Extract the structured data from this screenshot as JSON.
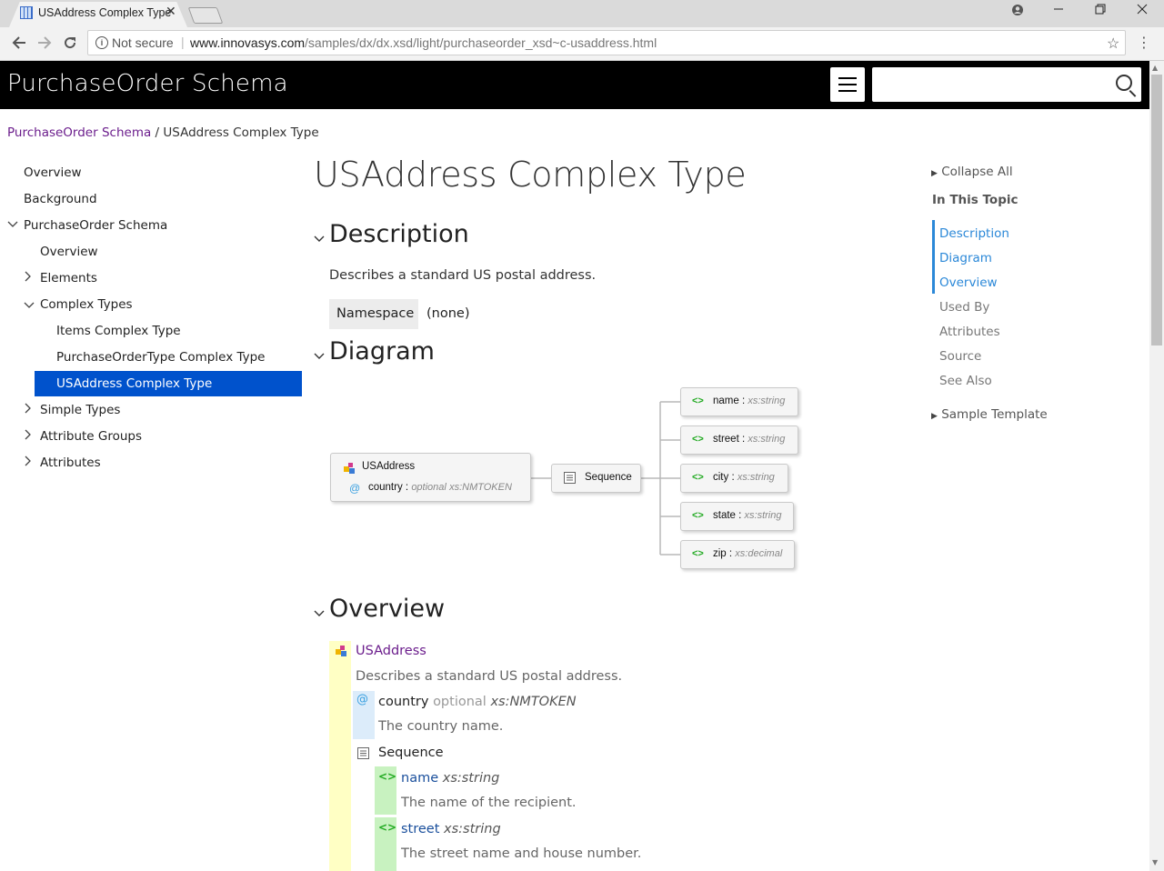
{
  "browser": {
    "tab_title": "USAddress Complex Type",
    "tab_close": "✕",
    "security_label": "Not secure",
    "url_domain": "www.innovasys.com",
    "url_path": "/samples/dx/dx.xsd/light/purchaseorder_xsd~c-usaddress.html"
  },
  "header": {
    "site_title": "PurchaseOrder Schema",
    "search_placeholder": ""
  },
  "breadcrumb": {
    "parent": "PurchaseOrder Schema",
    "separator": "/",
    "current": "USAddress Complex Type"
  },
  "nav": {
    "overview": "Overview",
    "background": "Background",
    "schema": "PurchaseOrder Schema",
    "schema_overview": "Overview",
    "elements": "Elements",
    "complex_types": "Complex Types",
    "items_ct": "Items Complex Type",
    "purchaseordertype_ct": "PurchaseOrderType Complex Type",
    "usaddress_ct": "USAddress Complex Type",
    "simple_types": "Simple Types",
    "attribute_groups": "Attribute Groups",
    "attributes": "Attributes"
  },
  "main": {
    "title": "USAddress Complex Type",
    "description_heading": "Description",
    "description_text": "Describes a standard US postal address.",
    "namespace_label": "Namespace",
    "namespace_value": "(none)",
    "diagram_heading": "Diagram",
    "overview_heading": "Overview"
  },
  "diagram": {
    "type_name": "USAddress",
    "attr_name": "country :",
    "attr_modifier": "optional",
    "attr_type": "xs:NMTOKEN",
    "sequence_label": "Sequence",
    "elements": [
      {
        "icon": "<>",
        "name": "name :",
        "type": "xs:string"
      },
      {
        "icon": "<>",
        "name": "street :",
        "type": "xs:string"
      },
      {
        "icon": "<>",
        "name": "city :",
        "type": "xs:string"
      },
      {
        "icon": "<>",
        "name": "state :",
        "type": "xs:string"
      },
      {
        "icon": "<>",
        "name": "zip :",
        "type": "xs:decimal"
      }
    ]
  },
  "right_toc": {
    "collapse_all": "Collapse All",
    "in_this_topic": "In This Topic",
    "links": [
      "Description",
      "Diagram",
      "Overview",
      "Used By",
      "Attributes",
      "Source",
      "See Also"
    ],
    "sample_template": "Sample Template"
  },
  "overview": {
    "type_name": "USAddress",
    "type_desc": "Describes a standard US postal address.",
    "attr_icon": "@",
    "attr_name": "country",
    "attr_modifier": "optional",
    "attr_type": "xs:NMTOKEN",
    "attr_desc": "The country name.",
    "sequence_label": "Sequence",
    "elements": [
      {
        "icon": "<>",
        "name": "name",
        "type": "xs:string",
        "desc": "The name of the recipient."
      },
      {
        "icon": "<>",
        "name": "street",
        "type": "xs:string",
        "desc": "The street name and house number."
      }
    ]
  },
  "colors": {
    "header_bg": "#000000",
    "nav_selected_bg": "#0052cc",
    "link_purple": "#6b1d8c",
    "toc_accent": "#2b88d8",
    "overview_type_band": "#ffffc4",
    "overview_attr_band": "#dcecfa",
    "overview_elem_band": "#c8f2c0"
  }
}
